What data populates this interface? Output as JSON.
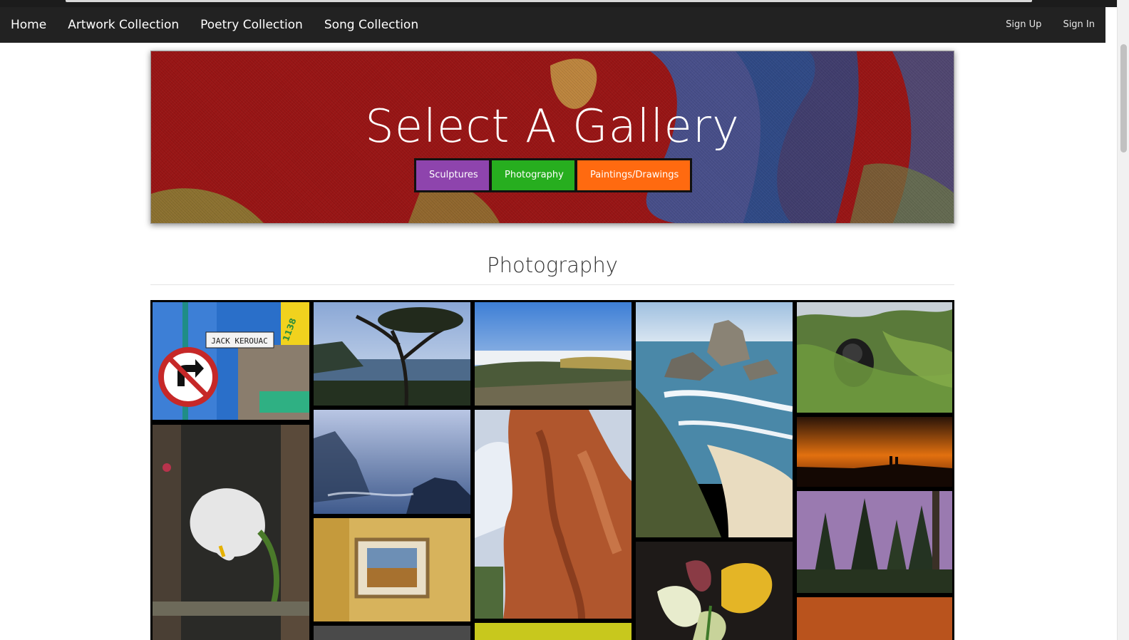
{
  "nav": {
    "left": [
      "Home",
      "Artwork Collection",
      "Poetry Collection",
      "Song Collection"
    ],
    "right": [
      "Sign Up",
      "Sign In"
    ]
  },
  "hero": {
    "title": "Select A Gallery",
    "buttons": {
      "sculptures": "Sculptures",
      "photography": "Photography",
      "paintings": "Paintings/Drawings"
    },
    "button_colors": {
      "sculptures": "#8e44ad",
      "photography": "#27ae1f",
      "paintings": "#ff6a10"
    }
  },
  "section": {
    "title": "Photography"
  },
  "photos": [
    {
      "name": "photo-jack-kerouac-sign",
      "sign_text": "JACK KEROUAC",
      "number_text": "1138"
    },
    {
      "name": "photo-coastal-tree"
    },
    {
      "name": "photo-coastal-hills"
    },
    {
      "name": "photo-sea-stacks-beach"
    },
    {
      "name": "photo-gorilla-in-tree"
    },
    {
      "name": "photo-white-lily-painting"
    },
    {
      "name": "photo-misty-sea-rocks"
    },
    {
      "name": "photo-red-rock-formation"
    },
    {
      "name": "photo-orange-sunset"
    },
    {
      "name": "photo-framed-picture-on-wall"
    },
    {
      "name": "photo-calla-lilies"
    },
    {
      "name": "photo-purple-sky-pines"
    }
  ]
}
